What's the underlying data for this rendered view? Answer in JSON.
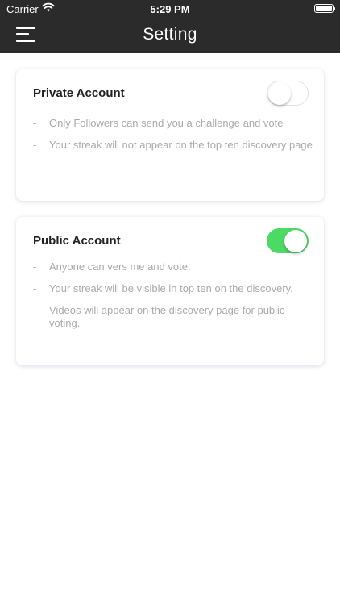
{
  "status_bar": {
    "carrier": "Carrier",
    "time": "5:29 PM"
  },
  "header": {
    "title": "Setting",
    "menu_icon": "hamburger-menu-icon"
  },
  "private_account": {
    "title": "Private Account",
    "toggle_on": false,
    "bullets": [
      "Only Followers can send you a challenge and vote",
      "Your streak will not appear on the top ten discovery page"
    ]
  },
  "public_account": {
    "title": "Public Account",
    "toggle_on": true,
    "bullets": [
      "Anyone can vers me and vote.",
      "Your streak will be visible in top ten on the discovery.",
      "Videos will appear on the discovery page for public voting."
    ]
  },
  "colors": {
    "header_bg": "#2b2b2b",
    "toggle_on": "#4cd964",
    "bullet_text": "#aaaaaa"
  },
  "bullet_marker": "-"
}
